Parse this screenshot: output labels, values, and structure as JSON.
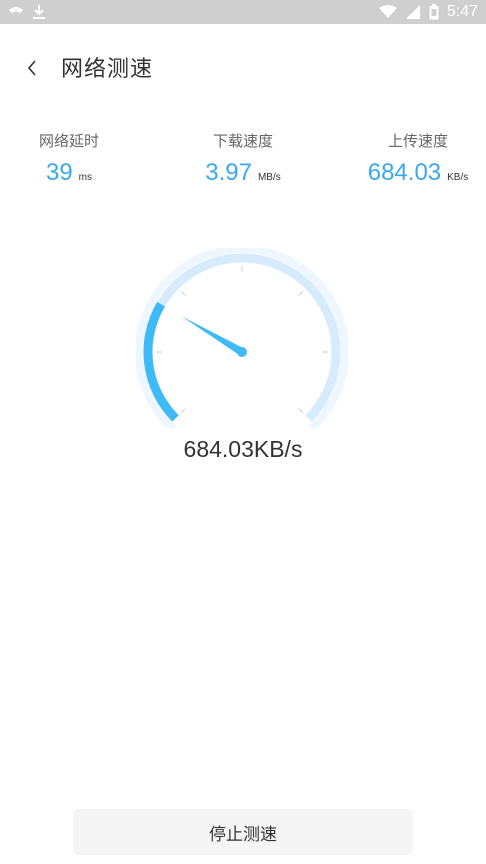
{
  "status_bar": {
    "time": "5:47",
    "left_icons": [
      "wifi-icon",
      "download-icon"
    ],
    "right_icons": [
      "wifi-signal-icon",
      "cell-signal-icon",
      "battery-icon"
    ]
  },
  "header": {
    "title": "网络测速",
    "back_icon": "chevron-left-icon"
  },
  "stats": [
    {
      "label": "网络延时",
      "value": "39",
      "unit": "ms"
    },
    {
      "label": "下载速度",
      "value": "3.97",
      "unit": "MB/s"
    },
    {
      "label": "上传速度",
      "value": "684.03",
      "unit": "KB/s"
    }
  ],
  "gauge": {
    "progress": 0.28,
    "needle_fraction": 0.28,
    "accent_color": "#3fbaf6",
    "track_color": "#d6ecfd",
    "readout": "684.03KB/s"
  },
  "actions": {
    "stop_label": "停止测速"
  }
}
